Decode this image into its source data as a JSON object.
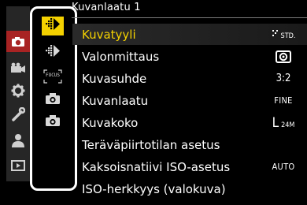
{
  "header": {
    "title": "Kuvanlaatu 1"
  },
  "tabs": [
    {
      "name": "camera-tab",
      "icon": "camera-icon",
      "active": true
    },
    {
      "name": "video-tab",
      "icon": "video-camera-icon",
      "active": false
    },
    {
      "name": "settings-tab",
      "icon": "gear-icon",
      "active": false
    },
    {
      "name": "custom-tab",
      "icon": "wrench-icon",
      "active": false
    },
    {
      "name": "user-tab",
      "icon": "person-icon",
      "active": false
    },
    {
      "name": "playback-tab",
      "icon": "play-icon",
      "active": false
    }
  ],
  "subtabs": [
    {
      "name": "image-quality-1-tab",
      "icon": "image-quality-icon",
      "active": true
    },
    {
      "name": "image-quality-2-tab",
      "icon": "image-quality-icon",
      "active": false
    },
    {
      "name": "focus-tab",
      "icon": "focus-icon",
      "label": "FOCUS",
      "active": false
    },
    {
      "name": "shooting-1-tab",
      "icon": "camera-icon",
      "active": false
    },
    {
      "name": "shooting-2-tab",
      "icon": "camera-icon",
      "active": false
    }
  ],
  "menu": [
    {
      "label": "Kuvatyyli",
      "value": "STD.",
      "value_icon": "photo-style-icon"
    },
    {
      "label": "Valonmittaus",
      "value": "",
      "value_icon": "metering-icon"
    },
    {
      "label": "Kuvasuhde",
      "value": "3:2"
    },
    {
      "label": "Kuvanlaatu",
      "value": "FINE"
    },
    {
      "label": "Kuvakoko",
      "value": "L",
      "value_sub": "24M"
    },
    {
      "label": "Teräväpiirtotilan asetus",
      "value": ""
    },
    {
      "label": "Kaksoisnatiivi ISO-asetus",
      "value": "AUTO"
    },
    {
      "label": "ISO-herkkyys (valokuva)",
      "value": ""
    }
  ],
  "selected_index": 0,
  "colors": {
    "accent": "#f4d100",
    "tab_active": "#a82323",
    "tab_strip": "#262626"
  }
}
